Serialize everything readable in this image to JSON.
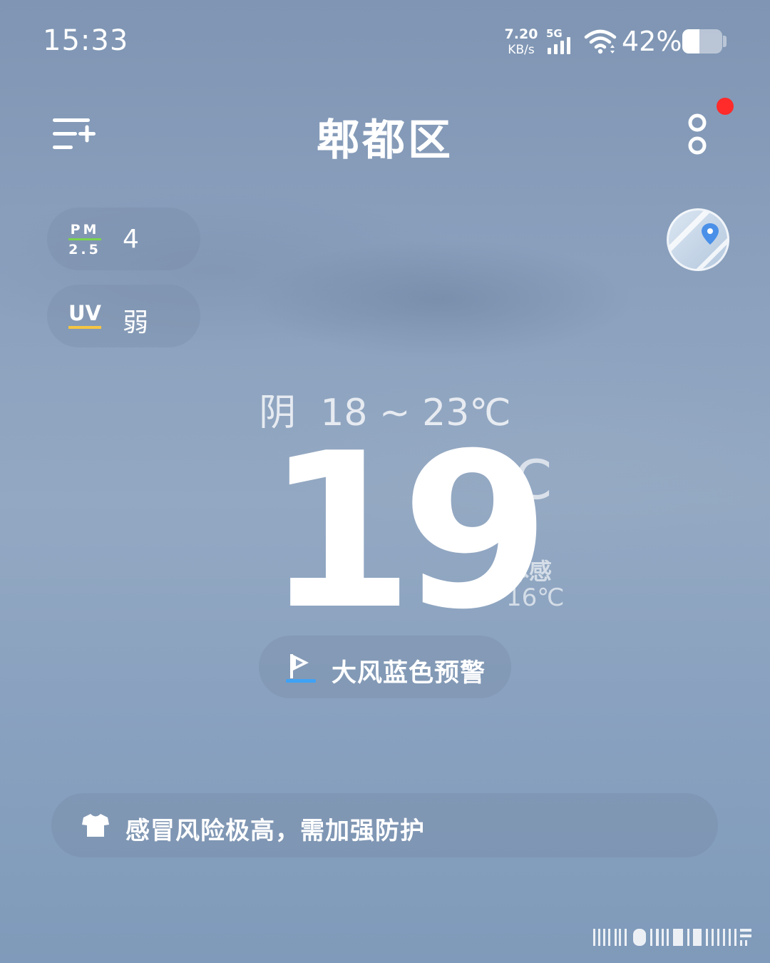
{
  "status_bar": {
    "time": "15:33",
    "net_speed_value": "7.20",
    "net_speed_unit": "KB/s",
    "network_type": "5G",
    "battery_percent": "42%",
    "battery_level": 0.42
  },
  "header": {
    "city": "郫都区",
    "has_notification": true,
    "notify_color": "#ff2a2a"
  },
  "air": {
    "pm_label_top": "PM",
    "pm_label_bottom": "2.5",
    "pm_value": "4",
    "pm_color": "#7bd44d",
    "uv_label": "UV",
    "uv_value": "弱",
    "uv_color": "#f5c542"
  },
  "weather": {
    "condition": "阴",
    "temp_range": "18 ~ 23℃",
    "current_temp": "19",
    "unit": "℃",
    "feels_label": "体感",
    "feels_value": "16℃"
  },
  "alert": {
    "text": "大风蓝色预警",
    "level_color": "#3fa2f5"
  },
  "tip": {
    "icon": "shirt-icon",
    "text": "感冒风险极高，需加强防护"
  },
  "icons": {
    "menu": "menu-add-icon",
    "more": "more-dots-icon",
    "map": "map-pin-icon",
    "alert": "flag-icon"
  }
}
